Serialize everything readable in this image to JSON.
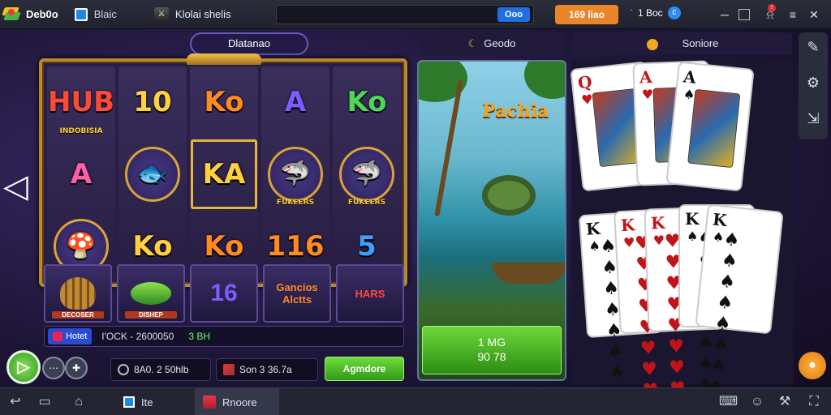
{
  "titlebar": {
    "app_name": "Deb0o",
    "tab_label": "Blaic",
    "game_title": "Klolai shelis",
    "search_button": "Ooo",
    "coin_button": "169 liao",
    "account_label": "1 Boc",
    "account_badge": "c"
  },
  "stage": {
    "title_pill": "Dlatanao",
    "slot_reels": [
      [
        {
          "text": "HUB",
          "sub": "INDOBISIA",
          "color": "c-red"
        },
        {
          "text": "A",
          "color": "c-pink"
        },
        {
          "text": "",
          "icon": "mushroom-icon",
          "color": "c-purple"
        }
      ],
      [
        {
          "text": "10",
          "color": "c-yellow"
        },
        {
          "text": "",
          "icon": "fish-icon",
          "color": "c-green"
        },
        {
          "text": "Ko",
          "color": "c-yellow"
        }
      ],
      [
        {
          "text": "Ko",
          "color": "c-orange"
        },
        {
          "text": "KA",
          "color": "c-yellow"
        },
        {
          "text": "Ko",
          "color": "c-orange"
        }
      ],
      [
        {
          "text": "A",
          "color": "c-purple"
        },
        {
          "text": "",
          "sub": "FUKEERS",
          "icon": "shark-icon",
          "color": "c-blue"
        },
        {
          "text": "116",
          "color": "c-orange"
        }
      ],
      [
        {
          "text": "Ko",
          "color": "c-green"
        },
        {
          "text": "",
          "sub": "FUKEERS",
          "icon": "shark-icon",
          "color": "c-pink"
        },
        {
          "text": "5",
          "color": "c-blue"
        }
      ]
    ],
    "lobby_tiles": [
      {
        "label": "",
        "caption": "DECOSER",
        "icon": "shell-icon"
      },
      {
        "label": "",
        "caption": "DISHEP",
        "icon": "fish-icon"
      },
      {
        "label": "16",
        "caption": ""
      },
      {
        "label": "Gancios Alctts",
        "caption": ""
      },
      {
        "label": "HARS",
        "caption": ""
      }
    ],
    "status_chip": "Hotet",
    "status_text": "I'OCK - 2600050",
    "status_value": "3 BH",
    "balance_1": "8A0. 2 50hlb",
    "balance_2": "Son 3 36.7a",
    "green_button": "Agmdore"
  },
  "fishing": {
    "header": "Geodo",
    "title": "Pachia",
    "cta_line1": "1 MG",
    "cta_line2": "90 78"
  },
  "cards": {
    "header": "Soniore",
    "top_row": [
      {
        "rank": "Q",
        "suit": "♥",
        "color": "red"
      },
      {
        "rank": "A",
        "suit": "♥",
        "color": "red"
      },
      {
        "rank": "A",
        "suit": "♠",
        "color": "black"
      }
    ],
    "bottom_row": [
      {
        "rank": "K",
        "suit": "♠",
        "color": "black"
      },
      {
        "rank": "K",
        "suit": "♥",
        "color": "red"
      },
      {
        "rank": "K",
        "suit": "♥",
        "color": "red"
      },
      {
        "rank": "K",
        "suit": "♠",
        "color": "black"
      },
      {
        "rank": "K",
        "suit": "♠",
        "color": "black"
      }
    ]
  },
  "taskbar": {
    "tab1": "Ite",
    "tab2": "Rnoore"
  }
}
